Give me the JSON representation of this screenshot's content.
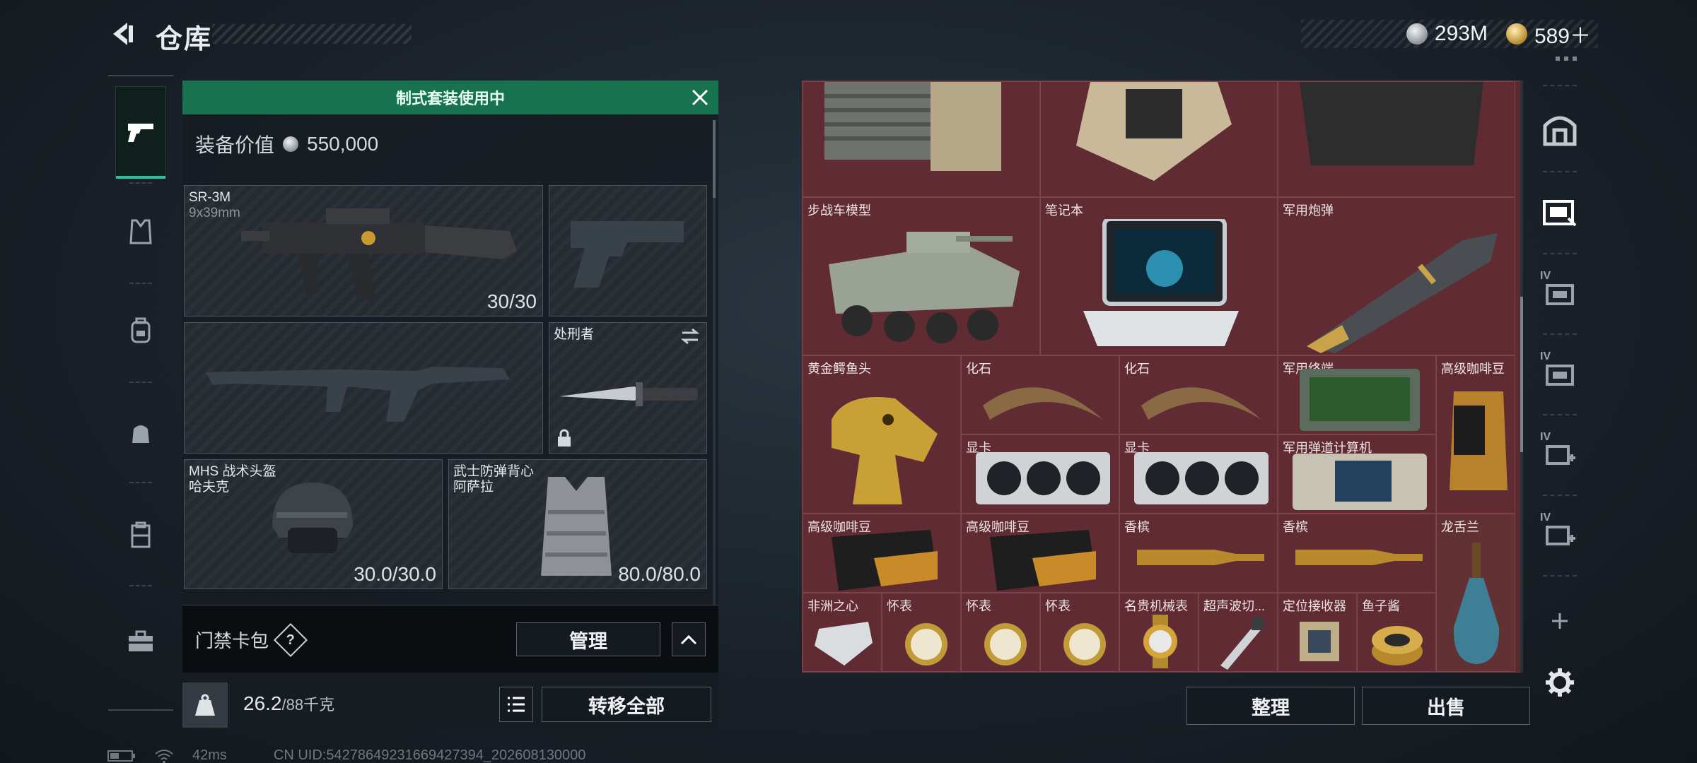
{
  "header": {
    "title": "仓库"
  },
  "currency": {
    "silver": "293M",
    "gold": "589＋"
  },
  "loadout": {
    "banner": "制式套装使用中",
    "value_label": "装备价值",
    "value": "550,000",
    "primary": {
      "name": "SR-3M",
      "ammo": "9x39mm",
      "count": "30/30"
    },
    "melee": {
      "name": "处刑者"
    },
    "helmet": {
      "name": "MHS 战术头盔",
      "sub": "哈夫克",
      "durability": "30.0/30.0"
    },
    "armor": {
      "name": "武士防弹背心",
      "sub": "阿萨拉",
      "durability": "80.0/80.0"
    }
  },
  "access_card": {
    "label": "门禁卡包",
    "help": "?",
    "manage": "管理"
  },
  "weight": {
    "current": "26.2",
    "max": "/88千克"
  },
  "transfer_all": "转移全部",
  "status": {
    "ping": "42ms",
    "uid": "CN UID:54278649231669427394_202608130000"
  },
  "stash": {
    "items": [
      {
        "label": "步战车模型"
      },
      {
        "label": "笔记本"
      },
      {
        "label": "军用炮弹"
      },
      {
        "label": "黄金鳄鱼头"
      },
      {
        "label": "化石"
      },
      {
        "label": "化石"
      },
      {
        "label": "军用终端"
      },
      {
        "label": "高级咖啡豆"
      },
      {
        "label": "显卡"
      },
      {
        "label": "显卡"
      },
      {
        "label": "军用弹道计算机"
      },
      {
        "label": "高级咖啡豆"
      },
      {
        "label": "高级咖啡豆"
      },
      {
        "label": "香槟"
      },
      {
        "label": "香槟"
      },
      {
        "label": "龙舌兰"
      },
      {
        "label": "非洲之心"
      },
      {
        "label": "怀表"
      },
      {
        "label": "怀表"
      },
      {
        "label": "怀表"
      },
      {
        "label": "名贵机械表"
      },
      {
        "label": "超声波切..."
      },
      {
        "label": "定位接收器"
      },
      {
        "label": "鱼子酱"
      }
    ],
    "sort": "整理",
    "sell": "出售"
  },
  "colors": {
    "accent": "#27c39a",
    "banner": "#17724f",
    "stash_bg": "#5a2a31"
  }
}
